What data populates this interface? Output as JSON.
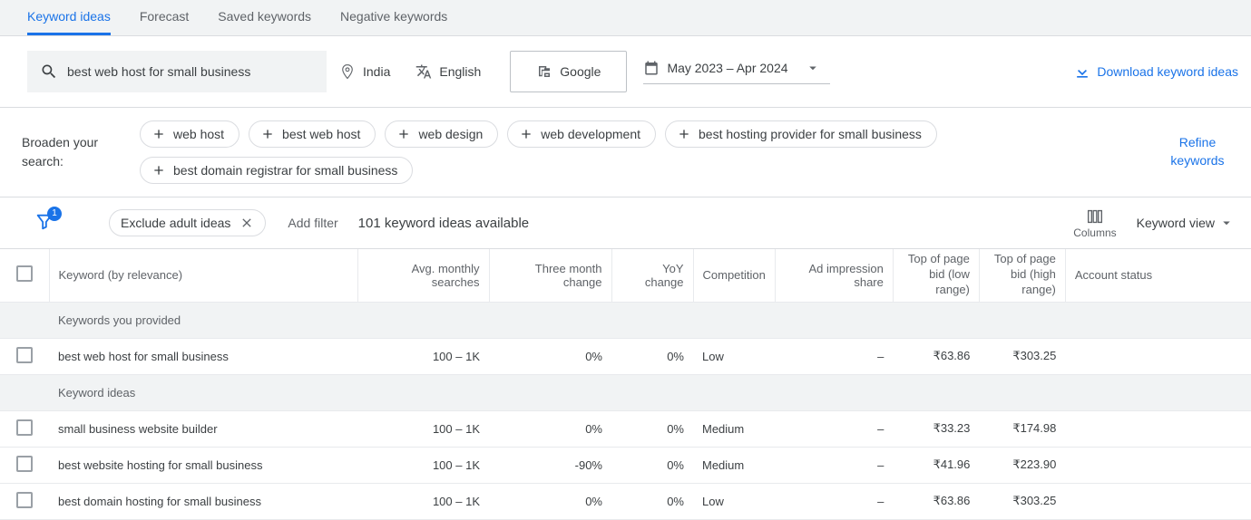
{
  "tabs": {
    "keyword_ideas": "Keyword ideas",
    "forecast": "Forecast",
    "saved_keywords": "Saved keywords",
    "negative_keywords": "Negative keywords"
  },
  "filters": {
    "search_value": "best web host for small business",
    "location": "India",
    "language": "English",
    "network": "Google",
    "date_range": "May 2023 – Apr 2024",
    "download_label": "Download keyword ideas"
  },
  "broaden": {
    "label_line1": "Broaden your",
    "label_line2": "search:",
    "chips": [
      "web host",
      "best web host",
      "web design",
      "web development",
      "best hosting provider for small business",
      "best domain registrar for small business"
    ],
    "refine_label": "Refine keywords"
  },
  "toolbar": {
    "filter_badge": "1",
    "exclude_label": "Exclude adult ideas",
    "add_filter": "Add filter",
    "ideas_count": "101 keyword ideas available",
    "columns_label": "Columns",
    "view_label": "Keyword view"
  },
  "columns": {
    "keyword": "Keyword (by relevance)",
    "avg": "Avg. monthly searches",
    "three_month": "Three month change",
    "yoy": "YoY change",
    "competition": "Competition",
    "ad_impression": "Ad impression share",
    "bid_low_l1": "Top of page",
    "bid_low_l2": "bid (low",
    "bid_low_l3": "range)",
    "bid_high_l1": "Top of page",
    "bid_high_l2": "bid (high",
    "bid_high_l3": "range)",
    "account_status": "Account status"
  },
  "sections": {
    "provided": "Keywords you provided",
    "ideas": "Keyword ideas"
  },
  "rows": [
    {
      "kw": "best web host for small business",
      "avg": "100 – 1K",
      "tmc": "0%",
      "yoy": "0%",
      "comp": "Low",
      "imp": "–",
      "low": "₹63.86",
      "high": "₹303.25",
      "status": ""
    },
    {
      "kw": "small business website builder",
      "avg": "100 – 1K",
      "tmc": "0%",
      "yoy": "0%",
      "comp": "Medium",
      "imp": "–",
      "low": "₹33.23",
      "high": "₹174.98",
      "status": ""
    },
    {
      "kw": "best website hosting for small business",
      "avg": "100 – 1K",
      "tmc": "-90%",
      "yoy": "0%",
      "comp": "Medium",
      "imp": "–",
      "low": "₹41.96",
      "high": "₹223.90",
      "status": ""
    },
    {
      "kw": "best domain hosting for small business",
      "avg": "100 – 1K",
      "tmc": "0%",
      "yoy": "0%",
      "comp": "Low",
      "imp": "–",
      "low": "₹63.86",
      "high": "₹303.25",
      "status": ""
    }
  ]
}
